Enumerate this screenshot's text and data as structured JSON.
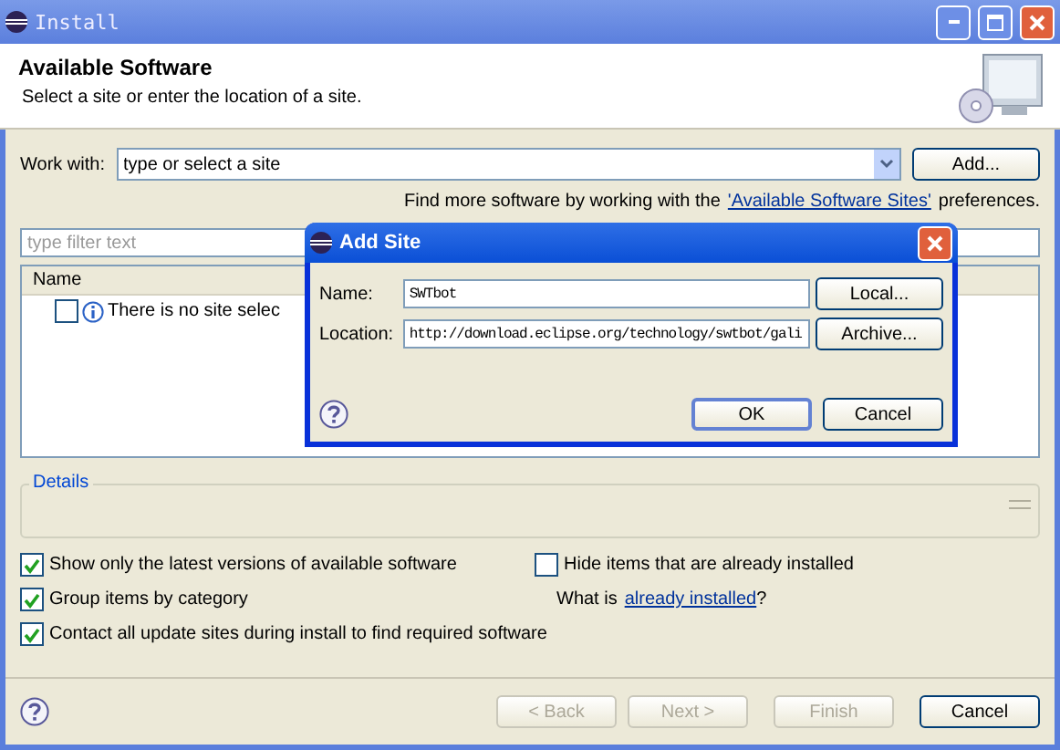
{
  "window": {
    "title": "Install"
  },
  "header": {
    "title": "Available Software",
    "description": "Select a site or enter the location of a site."
  },
  "work_with": {
    "label": "Work with:",
    "placeholder": "type or select a site",
    "button": "Add..."
  },
  "more_software": {
    "text": "Find more software by working with the",
    "link": "'Available Software Sites'",
    "suffix": "preferences."
  },
  "filter": {
    "placeholder": "type filter text"
  },
  "tree": {
    "columns": [
      "Name"
    ],
    "rows": [
      {
        "checked": false,
        "text": "There is no site selec"
      }
    ]
  },
  "details": {
    "title": "Details"
  },
  "options": [
    {
      "label": "Show only the latest versions of available software",
      "checked": true
    },
    {
      "label": "Group items by category",
      "checked": true
    },
    {
      "label": "Contact all update sites during install to find required software",
      "checked": true
    }
  ],
  "hide_installed": {
    "label": "Hide items that are already installed",
    "checked": false
  },
  "installed_note": {
    "prefix": "What is",
    "link": "already installed",
    "suffix": "?"
  },
  "buttons": [
    {
      "label": "< Back",
      "disabled": true
    },
    {
      "label": "Next >",
      "disabled": true
    },
    {
      "label": "Finish",
      "disabled": true
    },
    {
      "label": "Cancel",
      "disabled": false
    }
  ],
  "dialog": {
    "title": "Add Site",
    "fields": [
      {
        "label": "Name:",
        "value": "SWTbot",
        "button": "Local..."
      },
      {
        "label": "Location:",
        "value": "http://download.eclipse.org/technology/swtbot/gali",
        "button": "Archive..."
      }
    ],
    "buttons": [
      {
        "label": "OK",
        "default": true
      },
      {
        "label": "Cancel",
        "default": false
      }
    ]
  }
}
